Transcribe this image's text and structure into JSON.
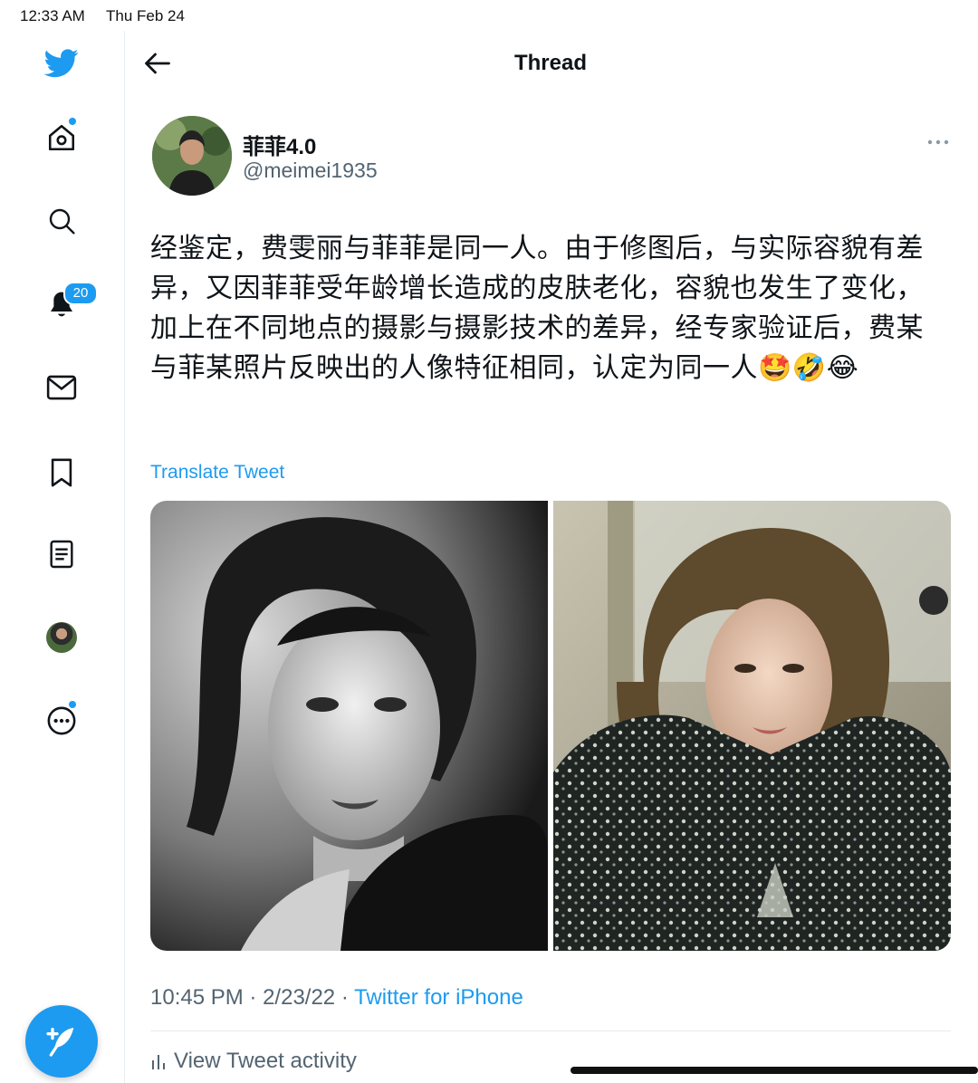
{
  "status_bar": {
    "time": "12:33 AM",
    "date": "Thu Feb 24"
  },
  "sidebar": {
    "notifications_badge": "20",
    "items": [
      {
        "name": "home",
        "icon": "home-icon"
      },
      {
        "name": "explore",
        "icon": "search-icon"
      },
      {
        "name": "notifications",
        "icon": "bell-icon"
      },
      {
        "name": "messages",
        "icon": "mail-icon"
      },
      {
        "name": "bookmarks",
        "icon": "bookmark-icon"
      },
      {
        "name": "lists",
        "icon": "list-icon"
      },
      {
        "name": "profile",
        "icon": "avatar"
      },
      {
        "name": "more",
        "icon": "more-circle-icon"
      }
    ]
  },
  "header": {
    "title": "Thread"
  },
  "tweet": {
    "author_name": "菲菲4.0",
    "author_handle": "@meimei1935",
    "text": "经鉴定，费雯丽与菲菲是同一人。由于修图后，与实际容貌有差异，又因菲菲受年龄增长造成的皮肤老化，容貌也发生了变化，加上在不同地点的摄影与摄影技术的差异，经专家验证后，费某与菲某照片反映出的人像特征相同，认定为同一人🤩🤣😂",
    "translate_label": "Translate Tweet",
    "time": "10:45 PM",
    "date": "2/23/22",
    "separator": "·",
    "source": "Twitter for iPhone",
    "activity_label": "View Tweet activity"
  },
  "colors": {
    "accent": "#1d9bf0",
    "text": "#0f1419",
    "secondary": "#536471",
    "divider": "#e6ecf0"
  }
}
